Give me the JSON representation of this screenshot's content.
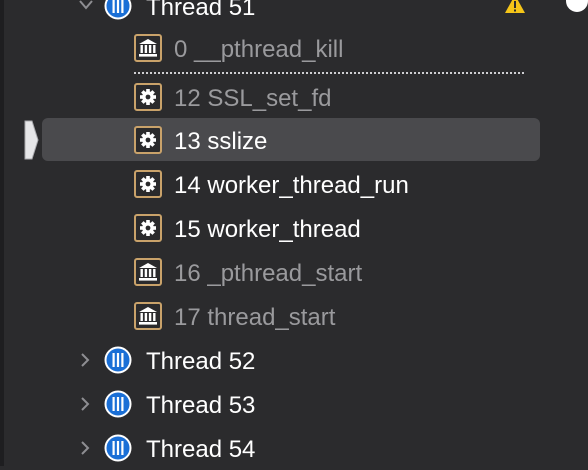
{
  "threads": [
    {
      "label": "Thread 51",
      "expanded": true,
      "warning": true
    },
    {
      "label": "Thread 52",
      "expanded": false
    },
    {
      "label": "Thread 53",
      "expanded": false
    },
    {
      "label": "Thread 54",
      "expanded": false
    }
  ],
  "frames": [
    {
      "label": "0 __pthread_kill",
      "kind": "system",
      "icon": "library-icon"
    },
    {
      "label": "12 SSL_set_fd",
      "kind": "user",
      "icon": "gear-icon"
    },
    {
      "label": "13 sslize",
      "kind": "user",
      "icon": "gear-icon",
      "selected": true
    },
    {
      "label": "14 worker_thread_run",
      "kind": "user",
      "icon": "gear-icon"
    },
    {
      "label": "15 worker_thread",
      "kind": "user",
      "icon": "gear-icon"
    },
    {
      "label": "16 _pthread_start",
      "kind": "system",
      "icon": "library-icon"
    },
    {
      "label": "17 thread_start",
      "kind": "system",
      "icon": "library-icon"
    }
  ],
  "colors": {
    "background": "#2b2b2d",
    "selection": "#4a4a4d",
    "thread_icon": "#1a6fd6",
    "frame_icon_user": "#c9a26a",
    "warning": "#f5c518"
  }
}
